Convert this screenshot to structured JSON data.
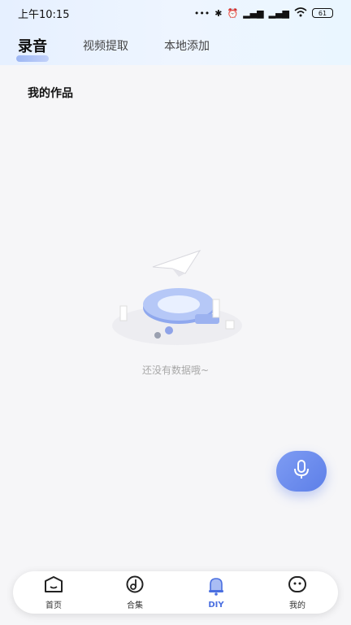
{
  "status": {
    "time": "上午10:15",
    "battery": "61"
  },
  "tabs": [
    {
      "label": "录音"
    },
    {
      "label": "视频提取"
    },
    {
      "label": "本地添加"
    }
  ],
  "section_title": "我的作品",
  "empty_text": "还没有数据哦~",
  "nav": [
    {
      "label": "首页",
      "icon": "home-icon"
    },
    {
      "label": "合集",
      "icon": "music-note-icon"
    },
    {
      "label": "DIY",
      "icon": "bell-icon"
    },
    {
      "label": "我的",
      "icon": "face-icon"
    }
  ],
  "colors": {
    "accent": "#5d7fe8",
    "nav_active": "#4a6fe0"
  }
}
